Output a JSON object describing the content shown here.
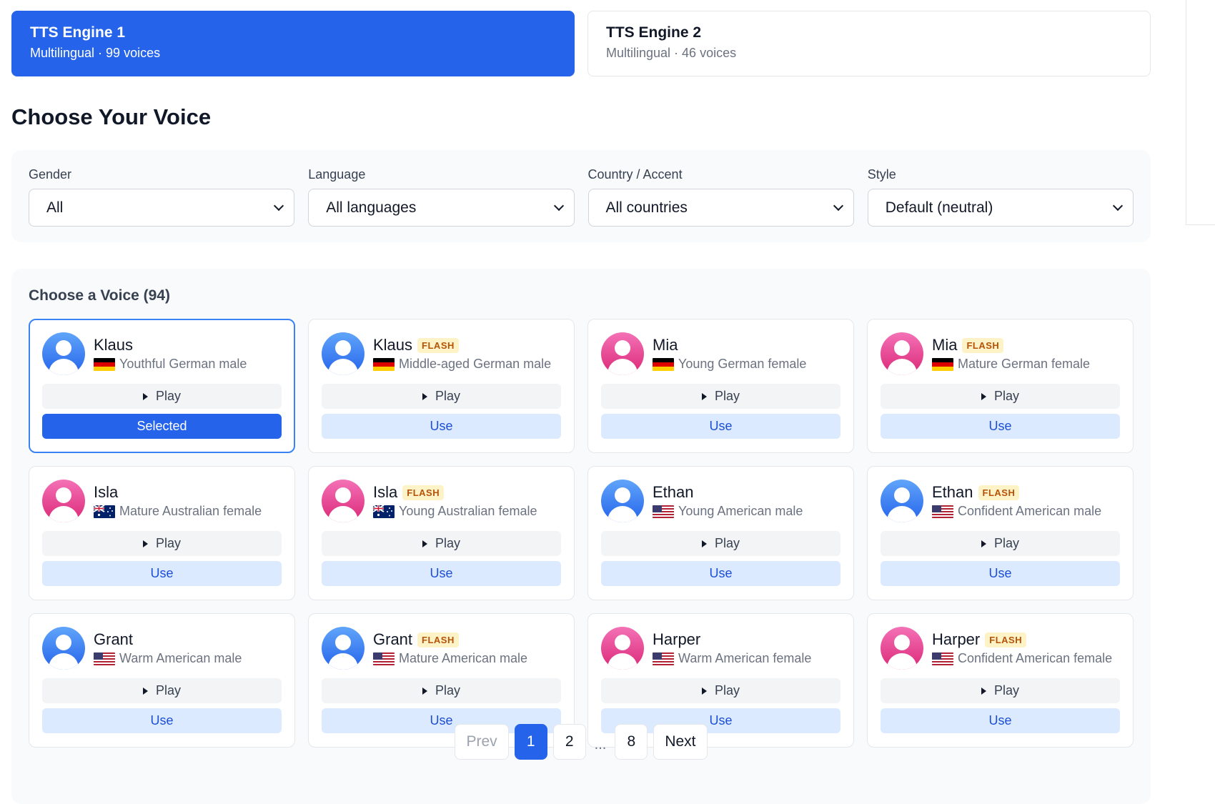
{
  "engines": [
    {
      "title": "TTS Engine 1",
      "subtitle": "Multilingual · 99 voices",
      "active": true
    },
    {
      "title": "TTS Engine 2",
      "subtitle": "Multilingual · 46 voices",
      "active": false
    }
  ],
  "page_title": "Choose Your Voice",
  "filters": [
    {
      "label": "Gender",
      "value": "All"
    },
    {
      "label": "Language",
      "value": "All languages"
    },
    {
      "label": "Country / Accent",
      "value": "All countries"
    },
    {
      "label": "Style",
      "value": "Default (neutral)"
    }
  ],
  "voices_section": {
    "title": "Choose a Voice (94)"
  },
  "flash_label": "FLASH",
  "play_label": "Play",
  "use_label": "Use",
  "selected_label": "Selected",
  "voices": [
    {
      "name": "Klaus",
      "flash": false,
      "gender": "male",
      "flag": "de",
      "desc": "Youthful German male",
      "selected": true
    },
    {
      "name": "Klaus",
      "flash": true,
      "gender": "male",
      "flag": "de",
      "desc": "Middle-aged German male",
      "selected": false
    },
    {
      "name": "Mia",
      "flash": false,
      "gender": "female",
      "flag": "de",
      "desc": "Young German female",
      "selected": false
    },
    {
      "name": "Mia",
      "flash": true,
      "gender": "female",
      "flag": "de",
      "desc": "Mature German female",
      "selected": false
    },
    {
      "name": "Isla",
      "flash": false,
      "gender": "female",
      "flag": "au",
      "desc": "Mature Australian female",
      "selected": false
    },
    {
      "name": "Isla",
      "flash": true,
      "gender": "female",
      "flag": "au",
      "desc": "Young Australian female",
      "selected": false
    },
    {
      "name": "Ethan",
      "flash": false,
      "gender": "male",
      "flag": "us",
      "desc": "Young American male",
      "selected": false
    },
    {
      "name": "Ethan",
      "flash": true,
      "gender": "male",
      "flag": "us",
      "desc": "Confident American male",
      "selected": false
    },
    {
      "name": "Grant",
      "flash": false,
      "gender": "male",
      "flag": "us",
      "desc": "Warm American male",
      "selected": false
    },
    {
      "name": "Grant",
      "flash": true,
      "gender": "male",
      "flag": "us",
      "desc": "Mature American male",
      "selected": false
    },
    {
      "name": "Harper",
      "flash": false,
      "gender": "female",
      "flag": "us",
      "desc": "Warm American female",
      "selected": false
    },
    {
      "name": "Harper",
      "flash": true,
      "gender": "female",
      "flag": "us",
      "desc": "Confident American female",
      "selected": false
    }
  ],
  "pagination": {
    "prev": "Prev",
    "next": "Next",
    "pages": [
      "1",
      "2",
      "8"
    ],
    "ellipsis": "...",
    "current": "1"
  },
  "colors": {
    "accent": "#2563eb",
    "male_avatar": "#3b82f6",
    "female_avatar": "#ec4899",
    "flash_bg": "#fef3c7"
  }
}
